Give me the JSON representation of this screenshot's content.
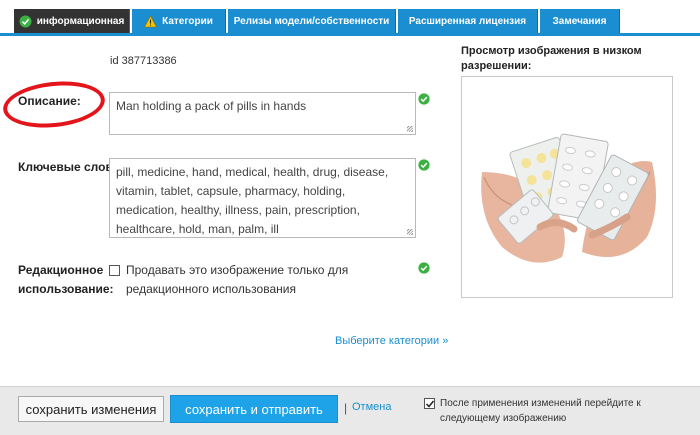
{
  "tabs": [
    {
      "label": "информационная",
      "icon": "check-circle-icon",
      "active": true
    },
    {
      "label": "Категории",
      "icon": "warning-icon",
      "active": false
    },
    {
      "label": "Релизы модели/собственности",
      "active": false
    },
    {
      "label": "Расширенная лицензия",
      "active": false
    },
    {
      "label": "Замечания",
      "active": false
    }
  ],
  "image_id": "id 387713386",
  "description": {
    "label": "Описание:",
    "value": "Man holding a pack of pills in hands"
  },
  "keywords": {
    "label": "Ключевые слова:",
    "value": "pill, medicine, hand, medical, health, drug, disease, vitamin, tablet, capsule, pharmacy, holding, medication, healthy, illness, pain, prescription, healthcare, hold, man, palm, ill"
  },
  "editorial": {
    "label_line1": "Редакционное",
    "label_line2": "использование:",
    "text": "Продавать это изображение только для редакционного использования",
    "checked": false
  },
  "choose_categories": "Выберите категории »",
  "preview": {
    "title": "Просмотр изображения в низком разрешении:"
  },
  "footer": {
    "save_label": "сохранить изменения",
    "submit_label": "сохранить и отправить",
    "separator": "|",
    "cancel_label": "Отмена",
    "next_label": "После применения изменений перейдите к следующему изображению",
    "next_checked": true
  },
  "colors": {
    "accent": "#1a8ed1",
    "active_tab": "#333333",
    "ok_green": "#3cb043",
    "annotation_red": "#e3141a",
    "submit": "#1fa3e8"
  }
}
